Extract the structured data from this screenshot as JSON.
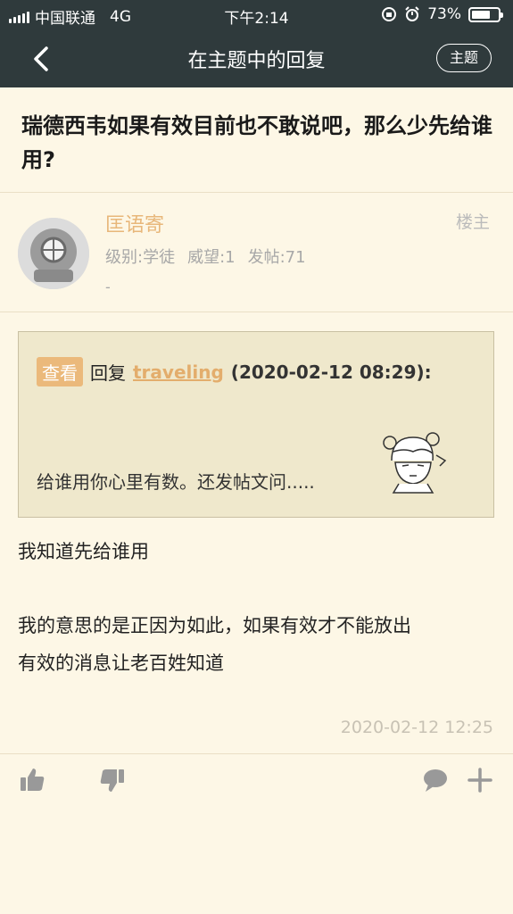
{
  "status": {
    "carrier": "中国联通",
    "network": "4G",
    "time": "下午2:14",
    "battery": "73%",
    "battery_level": 0.73
  },
  "nav": {
    "title": "在主题中的回复",
    "topic_button": "主题"
  },
  "thread": {
    "title": "瑞德西韦如果有效目前也不敢说吧，那么少先给谁用?"
  },
  "author": {
    "name": "匡语寄",
    "floor": "楼主",
    "level": "级别:学徒",
    "prestige": "威望:1",
    "posts": "发帖:71",
    "extra": "-"
  },
  "quote": {
    "badge": "查看",
    "reply_word": "回复",
    "user": "traveling",
    "time": "(2020-02-12 08:29):",
    "text": "给谁用你心里有数。还发帖文问....."
  },
  "post": {
    "line1": "我知道先给谁用",
    "line2": "我的意思的是正因为如此，如果有效才不能放出",
    "line3": "有效的消息让老百姓知道",
    "time": "2020-02-12 12:25"
  },
  "icons": {
    "like": "thumbs-up-icon",
    "dislike": "thumbs-down-icon",
    "comment": "comment-icon",
    "more": "plus-icon"
  },
  "colors": {
    "header": "#2f3a3c",
    "background": "#fdf7e6",
    "accent": "#e8b77a"
  }
}
